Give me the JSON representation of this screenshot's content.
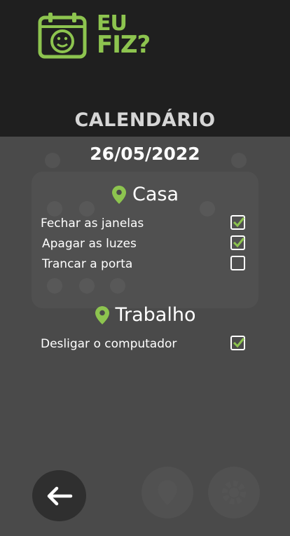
{
  "app": {
    "logo_text_line1": "EU",
    "logo_text_line2": "FIZ?"
  },
  "page_title": "CALENDÁRIO",
  "date": "26/05/2022",
  "sections": [
    {
      "title": "Casa",
      "tasks": [
        {
          "label": "Fechar as janelas",
          "checked": true
        },
        {
          "label": "Apagar as luzes",
          "checked": true
        },
        {
          "label": "Trancar a porta",
          "checked": false
        }
      ]
    },
    {
      "title": "Trabalho",
      "tasks": [
        {
          "label": "Desligar o computador",
          "checked": true
        }
      ]
    }
  ],
  "icons": {
    "logo": "calendar-smile-icon",
    "section": "location-pin-icon",
    "back": "arrow-left-icon",
    "location_button": "location-pin-icon",
    "settings_button": "gear-icon"
  },
  "colors": {
    "accent": "#8dc44f",
    "header_bg": "#1f1f1f",
    "body_bg": "#4a4a4a",
    "check": "#8dc44f"
  }
}
